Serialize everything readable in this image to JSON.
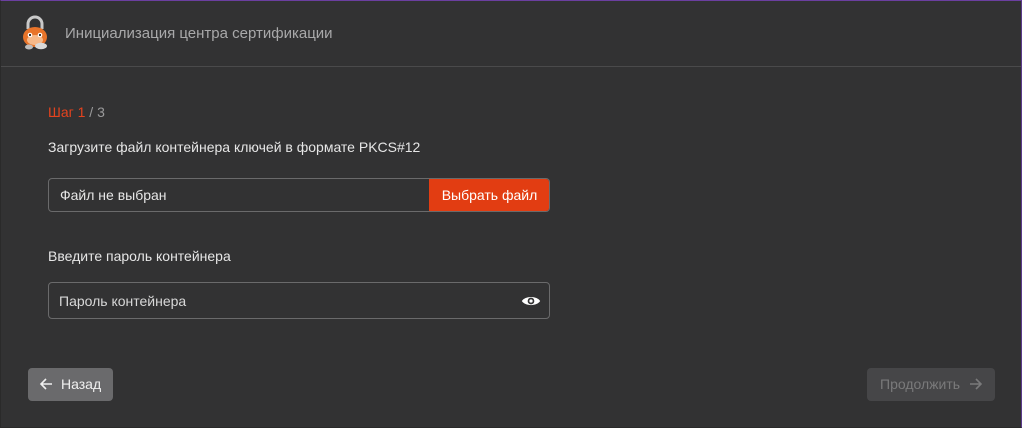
{
  "header": {
    "title": "Инициализация центра сертификации",
    "logo_icon": "lock-mascot-icon"
  },
  "step": {
    "current": "Шаг 1",
    "total": " / 3"
  },
  "upload": {
    "label": "Загрузите файл контейнера ключей в формате PKCS#12",
    "file_status": "Файл не выбран",
    "choose_button": "Выбрать файл"
  },
  "password": {
    "label": "Введите пароль контейнера",
    "placeholder": "Пароль контейнера",
    "toggle_icon": "eye-icon"
  },
  "footer": {
    "back_label": "Назад",
    "next_label": "Продолжить",
    "next_enabled": false
  },
  "colors": {
    "accent": "#e23d12",
    "step_current": "#e5431e",
    "background": "#323233",
    "border": "#6a6a6b"
  }
}
